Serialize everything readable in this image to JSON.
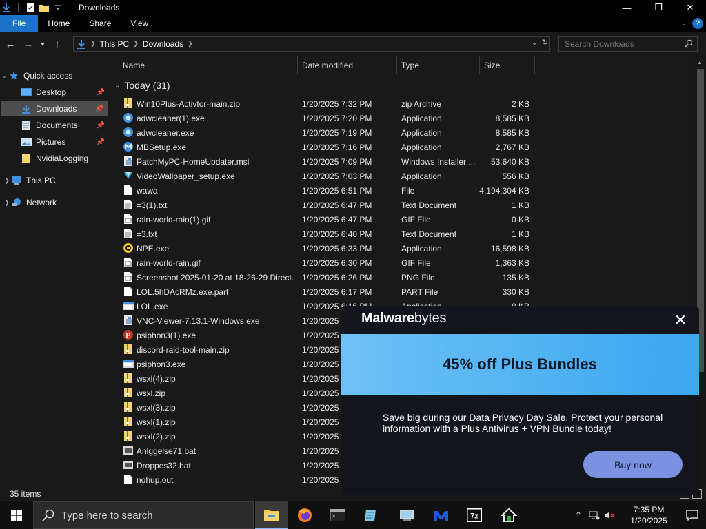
{
  "window": {
    "title": "Downloads",
    "controls": {
      "minimize": "—",
      "maximize": "❐",
      "close": "✕"
    }
  },
  "ribbon": {
    "tabs": [
      {
        "label": "File"
      },
      {
        "label": "Home"
      },
      {
        "label": "Share"
      },
      {
        "label": "View"
      }
    ],
    "help": "?"
  },
  "address": {
    "crumbs": [
      "This PC",
      "Downloads"
    ],
    "search_placeholder": "Search Downloads"
  },
  "nav": {
    "quick_access": "Quick access",
    "items": [
      {
        "label": "Desktop",
        "icon": "desktop-icon",
        "pinned": true
      },
      {
        "label": "Downloads",
        "icon": "downloads-icon",
        "pinned": true
      },
      {
        "label": "Documents",
        "icon": "documents-icon",
        "pinned": true
      },
      {
        "label": "Pictures",
        "icon": "pictures-icon",
        "pinned": true
      },
      {
        "label": "NvidiaLogging",
        "icon": "folder-icon",
        "pinned": false
      }
    ],
    "this_pc": "This PC",
    "network": "Network"
  },
  "columns": {
    "name": "Name",
    "date": "Date modified",
    "type": "Type",
    "size": "Size"
  },
  "group": {
    "label": "Today (31)"
  },
  "files": [
    {
      "name": "Win10Plus-Activtor-main.zip",
      "date": "1/20/2025 7:32 PM",
      "type": "zip Archive",
      "size": "2 KB",
      "icon": "zip"
    },
    {
      "name": "adwcleaner(1).exe",
      "date": "1/20/2025 7:20 PM",
      "type": "Application",
      "size": "8,585 KB",
      "icon": "adw"
    },
    {
      "name": "adwcleaner.exe",
      "date": "1/20/2025 7:19 PM",
      "type": "Application",
      "size": "8,585 KB",
      "icon": "adw"
    },
    {
      "name": "MBSetup.exe",
      "date": "1/20/2025 7:16 PM",
      "type": "Application",
      "size": "2,767 KB",
      "icon": "mb"
    },
    {
      "name": "PatchMyPC-HomeUpdater.msi",
      "date": "1/20/2025 7:09 PM",
      "type": "Windows Installer ...",
      "size": "53,640 KB",
      "icon": "msi"
    },
    {
      "name": "VideoWallpaper_setup.exe",
      "date": "1/20/2025 7:03 PM",
      "type": "Application",
      "size": "556 KB",
      "icon": "vw"
    },
    {
      "name": "wawa",
      "date": "1/20/2025 6:51 PM",
      "type": "File",
      "size": "4,194,304 KB",
      "icon": "file"
    },
    {
      "name": "=3(1).txt",
      "date": "1/20/2025 6:47 PM",
      "type": "Text Document",
      "size": "1 KB",
      "icon": "txt"
    },
    {
      "name": "rain-world-rain(1).gif",
      "date": "1/20/2025 6:47 PM",
      "type": "GIF File",
      "size": "0 KB",
      "icon": "img"
    },
    {
      "name": "=3.txt",
      "date": "1/20/2025 6:40 PM",
      "type": "Text Document",
      "size": "1 KB",
      "icon": "txt"
    },
    {
      "name": "NPE.exe",
      "date": "1/20/2025 6:33 PM",
      "type": "Application",
      "size": "16,598 KB",
      "icon": "npe"
    },
    {
      "name": "rain-world-rain.gif",
      "date": "1/20/2025 6:30 PM",
      "type": "GIF File",
      "size": "1,363 KB",
      "icon": "img"
    },
    {
      "name": "Screenshot 2025-01-20 at 18-26-29 Direct...",
      "date": "1/20/2025 6:26 PM",
      "type": "PNG File",
      "size": "135 KB",
      "icon": "img"
    },
    {
      "name": "LOL.5hDAcRMz.exe.part",
      "date": "1/20/2025 6:17 PM",
      "type": "PART File",
      "size": "330 KB",
      "icon": "file"
    },
    {
      "name": "LOL.exe",
      "date": "1/20/2025 6:16 PM",
      "type": "Application",
      "size": "8 KB",
      "icon": "app"
    },
    {
      "name": "VNC-Viewer-7.13.1-Windows.exe",
      "date": "1/20/2025",
      "type": "",
      "size": "",
      "icon": "msi"
    },
    {
      "name": "psiphon3(1).exe",
      "date": "1/20/2025",
      "type": "",
      "size": "",
      "icon": "psi"
    },
    {
      "name": "discord-raid-tool-main.zip",
      "date": "1/20/2025",
      "type": "",
      "size": "",
      "icon": "zip"
    },
    {
      "name": "psiphon3.exe",
      "date": "1/20/2025",
      "type": "",
      "size": "",
      "icon": "app"
    },
    {
      "name": "wsxl(4).zip",
      "date": "1/20/2025",
      "type": "",
      "size": "",
      "icon": "zip"
    },
    {
      "name": "wsxl.zip",
      "date": "1/20/2025",
      "type": "",
      "size": "",
      "icon": "zip"
    },
    {
      "name": "wsxl(3).zip",
      "date": "1/20/2025",
      "type": "",
      "size": "",
      "icon": "zip"
    },
    {
      "name": "wsxl(1).zip",
      "date": "1/20/2025",
      "type": "",
      "size": "",
      "icon": "zip"
    },
    {
      "name": "wsxl(2).zip",
      "date": "1/20/2025",
      "type": "",
      "size": "",
      "icon": "zip"
    },
    {
      "name": "Anlggelse71.bat",
      "date": "1/20/2025",
      "type": "",
      "size": "",
      "icon": "bat"
    },
    {
      "name": "Droppes32.bat",
      "date": "1/20/2025",
      "type": "",
      "size": "",
      "icon": "bat"
    },
    {
      "name": "nohup.out",
      "date": "1/20/2025",
      "type": "",
      "size": "",
      "icon": "file"
    }
  ],
  "status": {
    "count": "35 items"
  },
  "popup": {
    "brand_prefix": "M",
    "brand_bold": "alware",
    "brand_rest": "bytes",
    "headline": "45% off Plus Bundles",
    "body": "Save big during our Data Privacy Day Sale. Protect your personal information with a Plus Antivirus + VPN Bundle today!",
    "cta": "Buy now",
    "close": "✕",
    "colors": {
      "banner": "#3aa7ef",
      "button": "#7b92e0",
      "bg": "#12151c"
    }
  },
  "taskbar": {
    "search_placeholder": "Type here to search",
    "time": "7:35 PM",
    "date": "1/20/2025"
  },
  "colors": {
    "accent": "#1a73c9",
    "selected": "#4d4d4d",
    "background": "#191919"
  }
}
